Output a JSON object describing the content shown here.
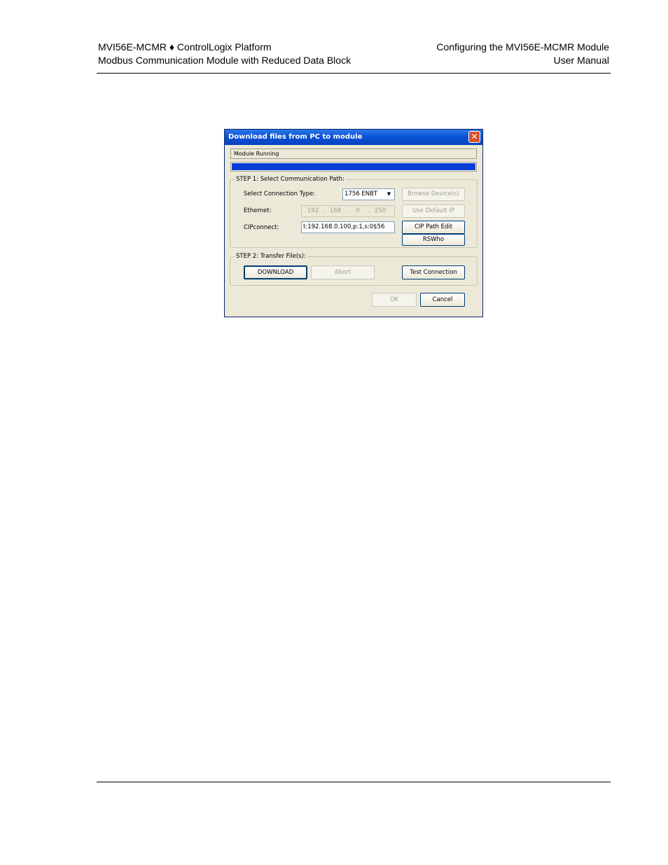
{
  "header": {
    "left_line1": "MVI56E-MCMR ♦ ControlLogix Platform",
    "left_line2": "Modbus Communication Module with Reduced Data Block",
    "right_line1": "Configuring the MVI56E-MCMR Module",
    "right_line2": "User Manual"
  },
  "dialog": {
    "title": "Download files from PC to module",
    "close_glyph": "✕",
    "status_text": "Module Running",
    "progress_fraction": 1.0,
    "step1": {
      "legend": "STEP 1: Select Communication Path:",
      "connection_type_label": "Select Connection Type:",
      "connection_type_value": "1756 ENBT",
      "dropdown_glyph": "▼",
      "browse_devices_label": "Browse Device(s)",
      "ethernet_label": "Ethernet:",
      "ip": [
        "192",
        "168",
        "0",
        "250"
      ],
      "ip_dot": ".",
      "use_default_ip_label": "Use Default IP",
      "cipconnect_label": "CIPconnect:",
      "cipconnect_value": "t:192.168.0.100,p:1,s:0$56",
      "cip_path_edit_label": "CIP Path Edit",
      "rswho_label": "RSWho"
    },
    "step2": {
      "legend": "STEP 2: Transfer File(s):",
      "download_label": "DOWNLOAD",
      "abort_label": "Abort",
      "test_connection_label": "Test Connection"
    },
    "ok_label": "OK",
    "cancel_label": "Cancel"
  }
}
